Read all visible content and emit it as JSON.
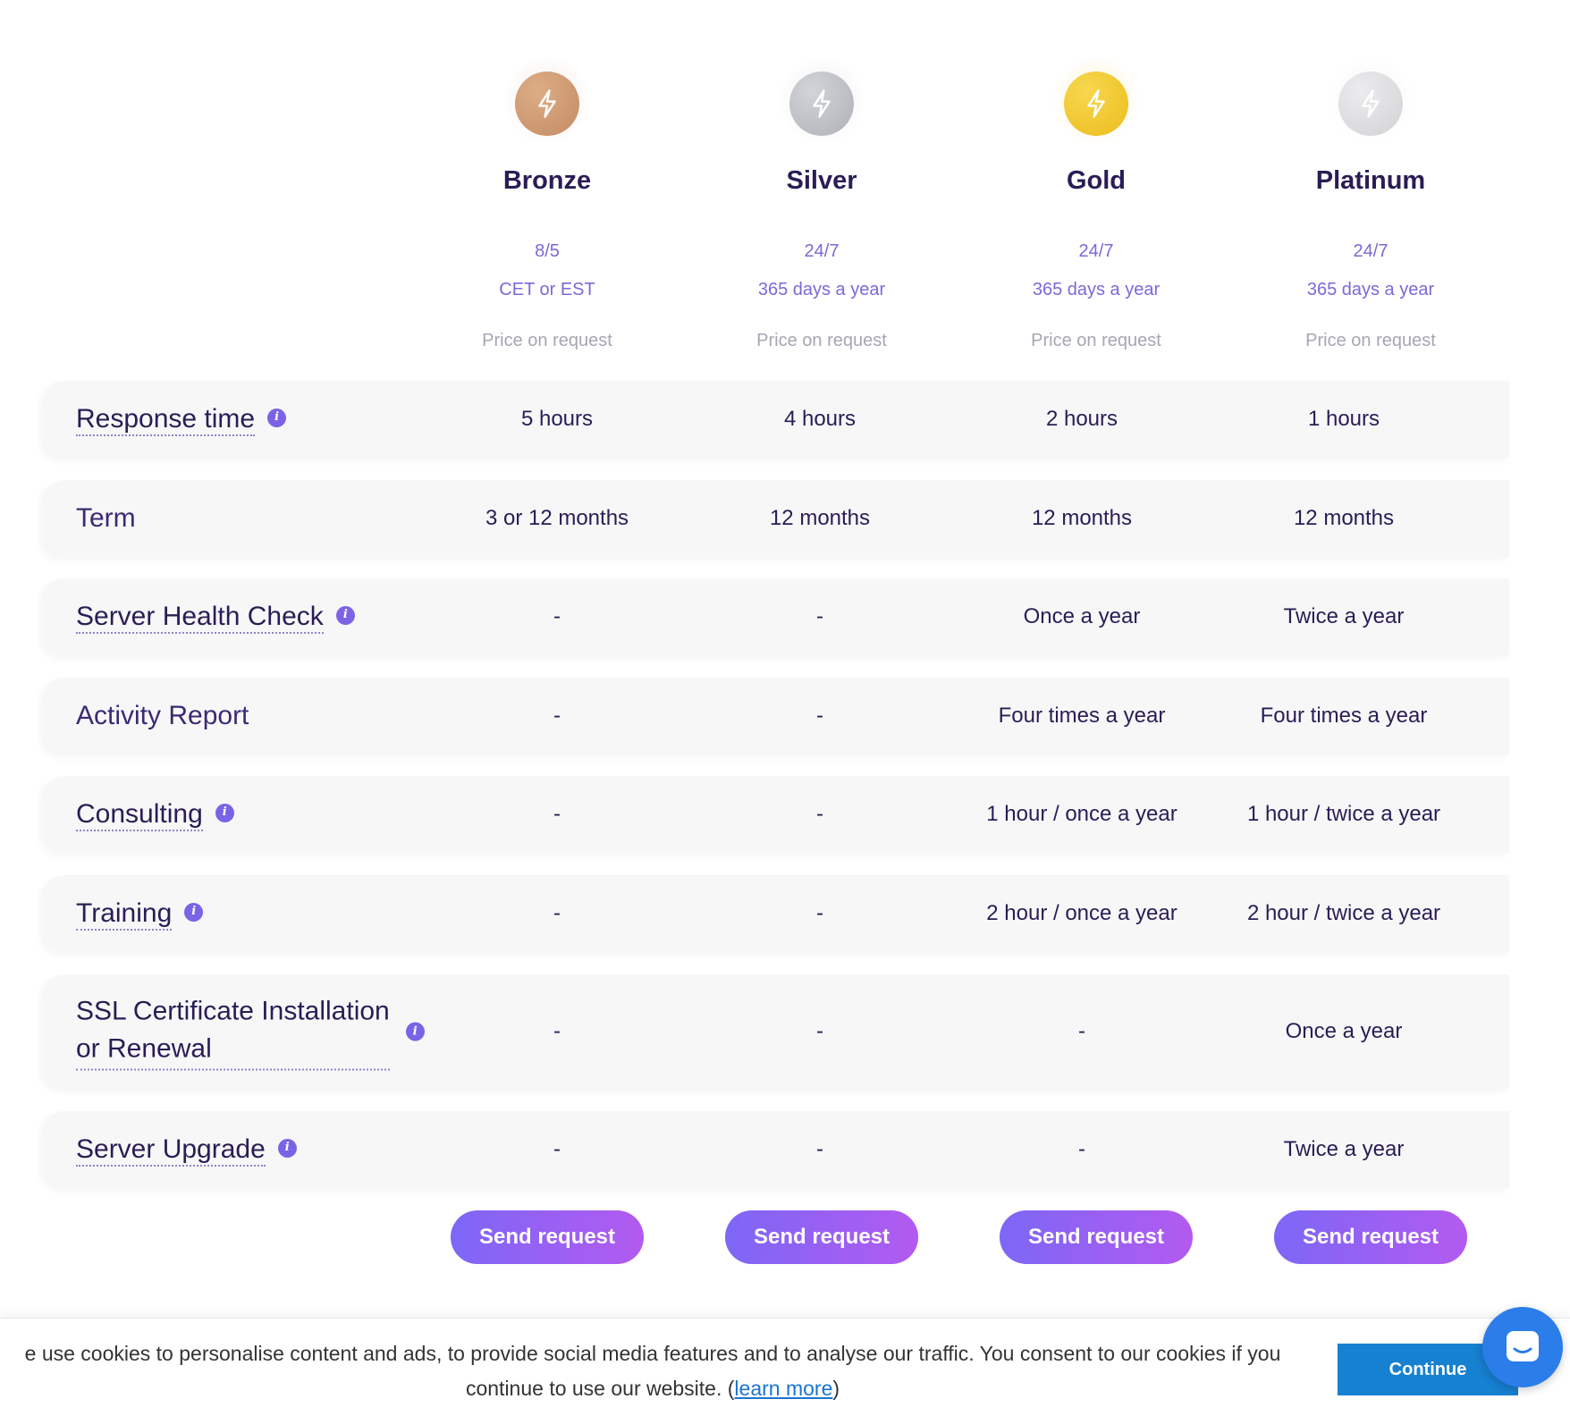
{
  "plans": [
    {
      "name": "Bronze",
      "availability": "8/5",
      "availability_note": "CET or EST",
      "price": "Price on request",
      "icon": "bolt-icon",
      "medal_color": "#c8916a"
    },
    {
      "name": "Silver",
      "availability": "24/7",
      "availability_note": "365 days a year",
      "price": "Price on request",
      "icon": "bolt-icon",
      "medal_color": "#b7b9be"
    },
    {
      "name": "Gold",
      "availability": "24/7",
      "availability_note": "365 days a year",
      "price": "Price on request",
      "icon": "bolt-icon",
      "medal_color": "#f0c531"
    },
    {
      "name": "Platinum",
      "availability": "24/7",
      "availability_note": "365 days a year",
      "price": "Price on request",
      "icon": "bolt-icon",
      "medal_color": "#dcdcde"
    }
  ],
  "features": [
    {
      "label": "Response time",
      "info": true,
      "values": [
        "5 hours",
        "4 hours",
        "2 hours",
        "1 hours"
      ]
    },
    {
      "label": "Term",
      "info": false,
      "values": [
        "3 or 12 months",
        "12 months",
        "12 months",
        "12 months"
      ]
    },
    {
      "label": "Server Health Check",
      "info": true,
      "values": [
        "-",
        "-",
        "Once a year",
        "Twice a year"
      ]
    },
    {
      "label": "Activity Report",
      "info": false,
      "values": [
        "-",
        "-",
        "Four times a year",
        "Four times a year"
      ]
    },
    {
      "label": "Consulting",
      "info": true,
      "values": [
        "-",
        "-",
        "1 hour / once a year",
        "1 hour / twice a year"
      ]
    },
    {
      "label": "Training",
      "info": true,
      "values": [
        "-",
        "-",
        "2 hour / once a year",
        "2 hour / twice a year"
      ]
    },
    {
      "label_line1": "SSL Certificate Installation",
      "label_line2": "or Renewal",
      "info": true,
      "values": [
        "-",
        "-",
        "-",
        "Once a year"
      ]
    },
    {
      "label": "Server Upgrade",
      "info": true,
      "values": [
        "-",
        "-",
        "-",
        "Twice a year"
      ]
    }
  ],
  "buttons": {
    "send_request": "Send request"
  },
  "info_icon": "i",
  "cookie": {
    "message_start": "e use cookies to personalise content and ads, to provide social media features and to analyse our traffic. You consent to our cookies if you",
    "message_end_pre": "continue to use our website. (",
    "link": "learn more",
    "message_end_post": ")",
    "continue": "Continue"
  },
  "colors": {
    "accent": "#7b63e6",
    "button_start": "#7d67f6",
    "button_end": "#b35af0",
    "cookie_button": "#1680d1",
    "chat_bubble": "#2b7de9"
  },
  "chat_icon": "chat-bubble-icon"
}
